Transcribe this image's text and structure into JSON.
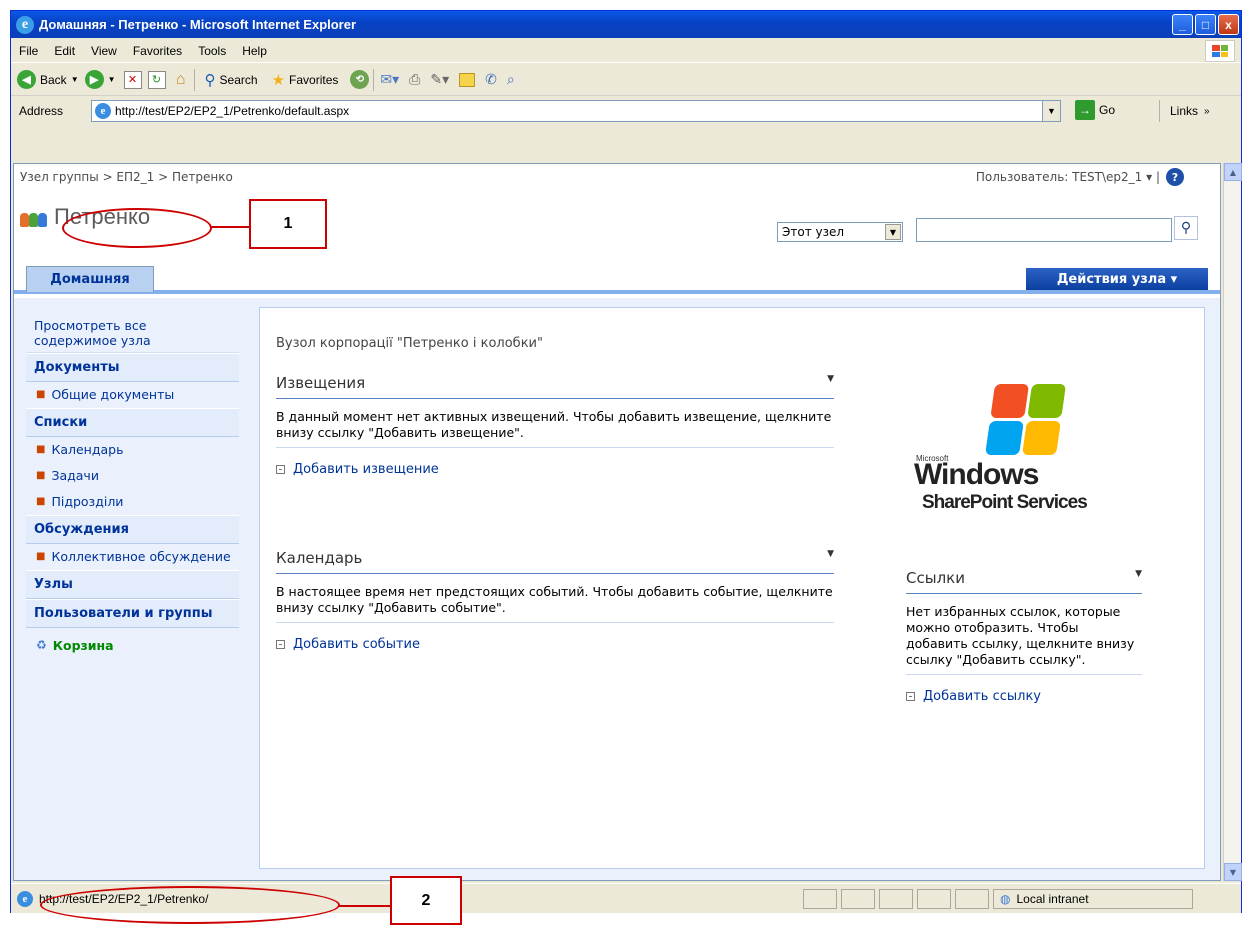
{
  "window": {
    "title": "Домашняя - Петренко - Microsoft Internet Explorer",
    "min": "_",
    "max": "□",
    "close": "x"
  },
  "menu": [
    "File",
    "Edit",
    "View",
    "Favorites",
    "Tools",
    "Help"
  ],
  "toolbar": {
    "back": "Back",
    "search": "Search",
    "favorites": "Favorites"
  },
  "address": {
    "label": "Address",
    "url": "http://test/EP2/EP2_1/Petrenko/default.aspx",
    "go": "Go",
    "links": "Links"
  },
  "page": {
    "breadcrumb": "Узел группы > ЕП2_1 > Петренко",
    "user": "Пользователь: TEST\\ep2_1 ▾  |",
    "site_title": "Петренко",
    "scope": "Этот узел",
    "tab_home": "Домашняя",
    "site_actions": "Действия узла ▾",
    "quicklaunch": {
      "view_all": "Просмотреть все содержимое узла",
      "documents": "Документы",
      "shared_docs": "Общие документы",
      "lists": "Списки",
      "calendar": "Календарь",
      "tasks": "Задачи",
      "subdivisions": "Підрозділи",
      "discussions": "Обсуждения",
      "team_discussion": "Коллективное обсуждение",
      "sites": "Узлы",
      "people": "Пользователи и группы",
      "recycle": "Корзина"
    },
    "welcome": "Вузол корпорації \"Петренко і колобки\"",
    "announcements": {
      "title": "Извещения",
      "empty": "В данный момент нет активных извещений. Чтобы добавить извещение, щелкните внизу ссылку \"Добавить извещение\".",
      "add": "Добавить извещение"
    },
    "calendar": {
      "title": "Календарь",
      "empty": "В настоящее время нет предстоящих событий. Чтобы добавить событие, щелкните внизу ссылку \"Добавить событие\".",
      "add": "Добавить событие"
    },
    "links": {
      "title": "Ссылки",
      "empty": "Нет избранных ссылок, которые можно отобразить. Чтобы добавить ссылку, щелкните внизу ссылку \"Добавить ссылку\".",
      "add": "Добавить ссылку"
    },
    "logo": {
      "microsoft": "Microsoft",
      "windows": "Windows",
      "sps": "SharePoint Services"
    }
  },
  "status": {
    "url": "http://test/EP2/EP2_1/Petrenko/",
    "zone": "Local intranet"
  },
  "annotations": {
    "one": "1",
    "two": "2"
  },
  "colors": {
    "accent": "#003399",
    "titlebar": "#0a58e6",
    "annotation": "#cc0000"
  }
}
